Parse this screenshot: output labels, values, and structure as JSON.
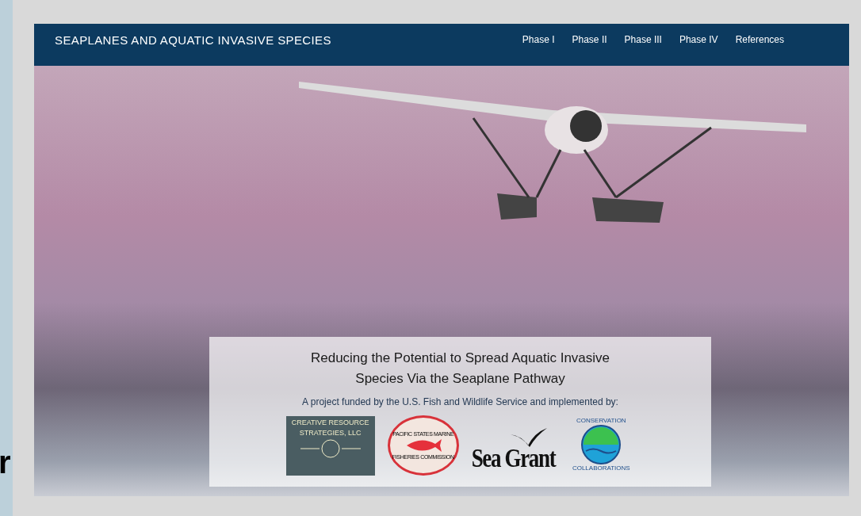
{
  "background_fragment": "r",
  "nav": {
    "title": "SEAPLANES AND AQUATIC INVASIVE SPECIES",
    "links": [
      {
        "label": "Phase I"
      },
      {
        "label": "Phase II"
      },
      {
        "label": "Phase III"
      },
      {
        "label": "Phase IV"
      },
      {
        "label": "References"
      }
    ]
  },
  "hero": {
    "heading": "Reducing the Potential to Spread Aquatic Invasive Species Via the Seaplane Pathway",
    "subheading": "A project funded by the U.S. Fish and Wildlife Service and implemented by:",
    "logos": [
      {
        "kind": "crs",
        "lines": [
          "CREATIVE RESOURCE",
          "STRATEGIES, LLC"
        ]
      },
      {
        "kind": "psmfc",
        "lines": [
          "PACIFIC STATES MARINE",
          "FISHERIES COMMISSION"
        ]
      },
      {
        "kind": "seagrant",
        "lines": [
          "Sea Grant"
        ]
      },
      {
        "kind": "conservation",
        "lines": [
          "CONSERVATION",
          "COLLABORATIONS"
        ]
      }
    ]
  }
}
